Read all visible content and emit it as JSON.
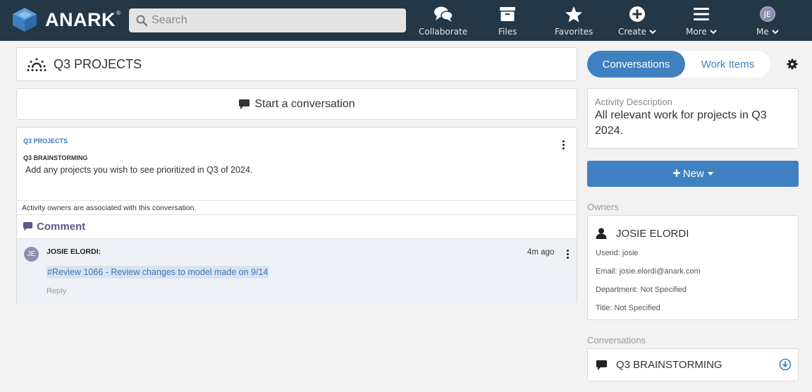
{
  "nav": {
    "brand": "ANARK",
    "brand_mark": "®",
    "search_placeholder": "Search",
    "items": [
      {
        "label": "Collaborate",
        "icon": "chat-bubbles-icon"
      },
      {
        "label": "Files",
        "icon": "archive-box-icon"
      },
      {
        "label": "Favorites",
        "icon": "star-icon"
      },
      {
        "label": "Create",
        "icon": "plus-circle-icon"
      },
      {
        "label": "More",
        "icon": "hamburger-icon"
      },
      {
        "label": "Me",
        "avatar": "JE"
      }
    ]
  },
  "page": {
    "title": "Q3 PROJECTS",
    "start_conversation": "Start a conversation"
  },
  "conversation": {
    "breadcrumb": "Q3 PROJECTS",
    "title": "Q3 BRAINSTORMING",
    "description": "Add any projects you wish to see prioritized in Q3 of 2024.",
    "owners_note": "Activity owners are associated with this conversation.",
    "comment_heading": "Comment",
    "comment": {
      "avatar": "JE",
      "author": "JOSIE ELORDI:",
      "time": "4m ago",
      "link_text": "#Review 1066 - Review changes to model made on 9/14",
      "reply": "Reply"
    }
  },
  "sidebar": {
    "tabs": [
      {
        "label": "Conversations",
        "active": true
      },
      {
        "label": "Work Items",
        "active": false
      }
    ],
    "activity_label": "Activity Description",
    "activity_value": "All relevant work for projects in Q3 2024.",
    "new_button": "New",
    "owners_label": "Owners",
    "owner": {
      "name": "JOSIE ELORDI",
      "userid": "Userid: josie",
      "email": "Email: josie.elordi@anark.com",
      "department": "Department: Not Specified",
      "title": "Title: Not Specified"
    },
    "conversations_label": "Conversations",
    "conversations": [
      {
        "name": "Q3 BRAINSTORMING"
      }
    ]
  },
  "colors": {
    "nav_bg": "#233746",
    "accent": "#3f81c0",
    "page_bg": "#f2f2f2",
    "comment_bg": "#eef2f6"
  }
}
